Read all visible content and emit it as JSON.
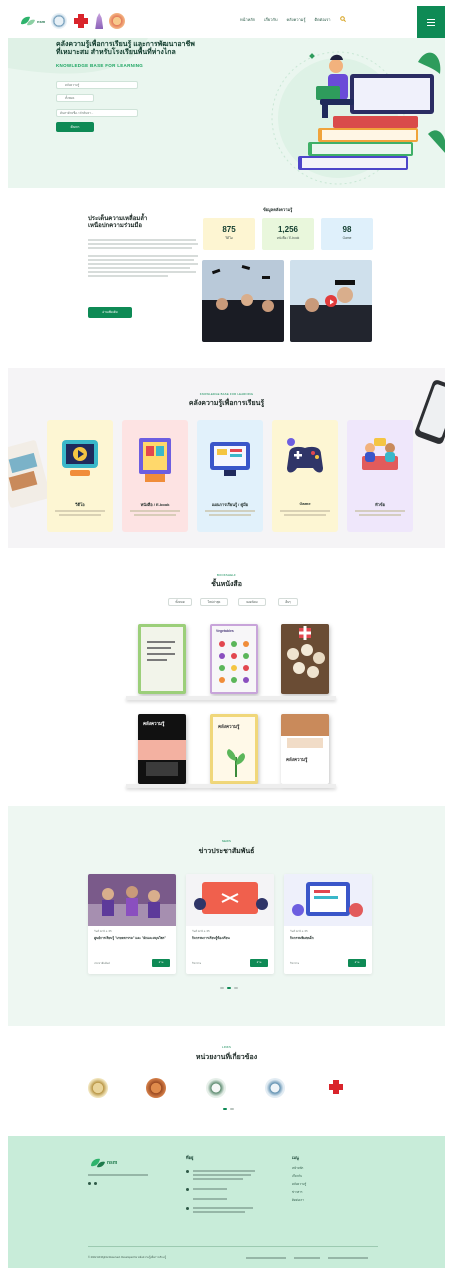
{
  "header": {
    "nav": [
      "หน้าหลัก",
      "เกี่ยวกับ",
      "คลังความรู้",
      "ติดต่อเรา"
    ],
    "brand": "nsm"
  },
  "hero": {
    "title_line1": "คลังความรู้เพื่อการเรียนรู้ และการพัฒนาอาชีพ",
    "title_line2": "ที่เหมาะสม สำหรับโรงเรียนพื้นที่ห่างไกล",
    "subtitle": "KNOWLEDGE BASE FOR LEARNING",
    "select1": "คลังความรู้",
    "select2": "ทั้งหมด",
    "search_placeholder": "ค้นหาด้วยชื่อ / คำค้นหา...",
    "search_button": "ค้นหา"
  },
  "about": {
    "title_line1": "ประเด็นความเหลื่อมล้ำ",
    "title_line2": "เหนือปกความร่วมมือ",
    "button": "อ่านเพิ่มเติม",
    "stats_title": "ข้อมูลคลังความรู้",
    "stats": [
      {
        "value": "875",
        "label": "วีดีโอ"
      },
      {
        "value": "1,256",
        "label": "หนังสือ / E-book"
      },
      {
        "value": "98",
        "label": "Game"
      }
    ]
  },
  "knowledge": {
    "eyebrow": "KNOWLEDGE BASE FOR LEARNING",
    "title": "คลังความรู้เพื่อการเรียนรู้",
    "cards": [
      {
        "title": "วีดีโอ",
        "color": "#fdf6d3"
      },
      {
        "title": "หนังสือ / E-book",
        "color": "#fde3e3"
      },
      {
        "title": "แผนการเรียนรู้ / คู่มือ",
        "color": "#e1f1fb"
      },
      {
        "title": "Game",
        "color": "#fdf6d3"
      },
      {
        "title": "หัวข้อ",
        "color": "#efe7fb"
      }
    ]
  },
  "shelf": {
    "eyebrow": "BOOKSHELF",
    "title": "ชั้นหนังสือ",
    "chips": [
      "ทั้งหมด",
      "ใหม่ล่าสุด",
      "ยอดนิยม",
      "อื่นๆ"
    ],
    "books": [
      {
        "cover_text": ""
      },
      {
        "cover_text": "Vegetables"
      },
      {
        "cover_text": ""
      },
      {
        "cover_text": "คลังความรู้"
      },
      {
        "cover_text": "คลังความรู้"
      },
      {
        "cover_text": "คลังความรู้"
      }
    ]
  },
  "news": {
    "eyebrow": "NEWS",
    "title": "ข่าวประชาสัมพันธ์",
    "items": [
      {
        "date": "วันที่ 12 มิ.ย. 65",
        "title": "ศูนย์การเรียนรู้ \"เกษตรกรรม\" และ \"ผักและสมุนไพร\"",
        "meta": "ประชาสัมพันธ์",
        "button": "อ่าน"
      },
      {
        "date": "วันที่ 12 มิ.ย. 65",
        "title": "กิจกรรมการเรียนรู้ห้องเรียน",
        "meta": "กิจกรรม",
        "button": "อ่าน"
      },
      {
        "date": "วันที่ 12 มิ.ย. 65",
        "title": "กิจกรรมพิเศษเด็ก",
        "meta": "กิจกรรม",
        "button": "อ่าน"
      }
    ]
  },
  "agencies": {
    "eyebrow": "LINKS",
    "title": "หน่วยงานที่เกี่ยวข้อง"
  },
  "footer": {
    "brand": "nsm",
    "col1_title": "ที่อยู่",
    "col2_title": "เมนู",
    "col2_items": [
      "หน้าหลัก",
      "เกี่ยวกับ",
      "คลังความรู้",
      "ข่าวสาร",
      "ติดต่อเรา"
    ],
    "copyright": "© 2022 All Rights Reserved. Developed for คลังความรู้เพื่อการเรียนรู้"
  },
  "colors": {
    "primary": "#0e8a55",
    "hero_bg": "#eaf6ef",
    "footer_bg": "#c8ecd9"
  }
}
